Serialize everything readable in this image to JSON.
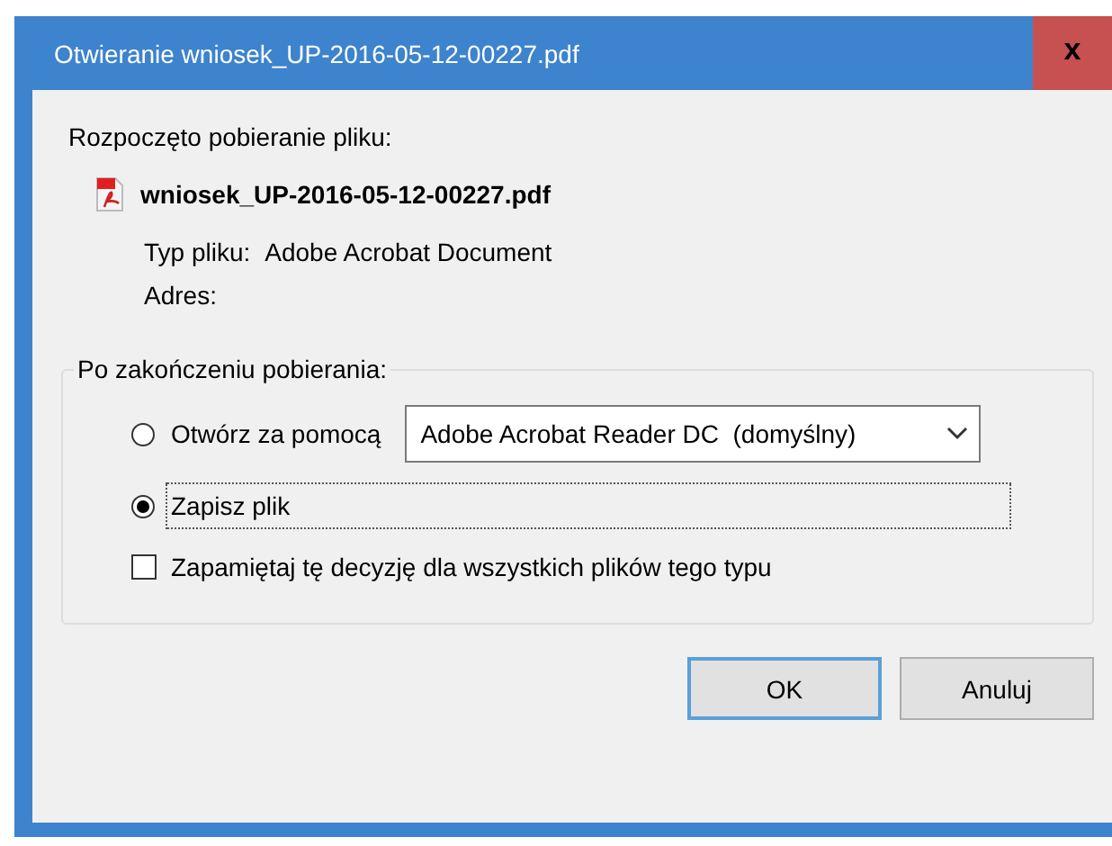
{
  "window": {
    "title": "Otwieranie wniosek_UP-2016-05-12-00227.pdf",
    "close_glyph": "x"
  },
  "download": {
    "heading": "Rozpoczęto pobieranie pliku:",
    "file_name": "wniosek_UP-2016-05-12-00227.pdf",
    "type_label": "Typ pliku:",
    "type_value": "Adobe Acrobat Document",
    "address_label": "Adres:"
  },
  "after_download": {
    "legend": "Po zakończeniu pobierania:",
    "options": [
      {
        "kind": "open_with",
        "label": "Otwórz za pomocą",
        "selected": false,
        "focused": false,
        "app": "Adobe Acrobat Reader DC  (domyślny)"
      },
      {
        "kind": "save",
        "label": "Zapisz plik",
        "selected": true,
        "focused": true
      }
    ],
    "remember": {
      "label": "Zapamiętaj tę decyzję dla wszystkich plików tego typu",
      "checked": false
    }
  },
  "buttons": [
    {
      "label": "OK",
      "default": true
    },
    {
      "label": "Anuluj",
      "default": false
    }
  ]
}
